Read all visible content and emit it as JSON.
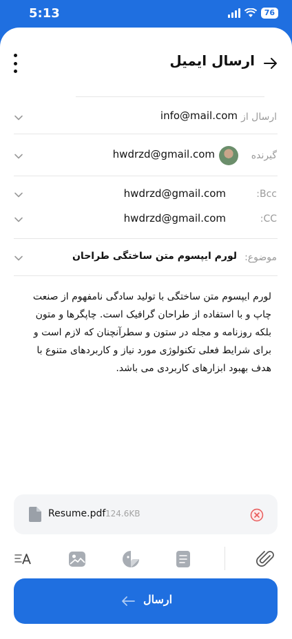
{
  "status": {
    "time": "5:13",
    "battery": "76"
  },
  "header": {
    "title": "ارسال ایمیل"
  },
  "fields": {
    "from": {
      "label": "ارسال از",
      "value": "info@mail.com"
    },
    "to": {
      "label": "گیرنده",
      "value": "hwdrzd@gmail.com"
    },
    "bcc": {
      "label": "Bcc:",
      "value": "hwdrzd@gmail.com"
    },
    "cc": {
      "label": "CC:",
      "value": "hwdrzd@gmail.com"
    },
    "subject": {
      "label": "موضوع:",
      "value": "لورم ایپسوم متن ساختگی طراحان"
    }
  },
  "body": "لورم ایپسوم متن ساختگی با تولید سادگی نامفهوم از صنعت چاپ و با استفاده از طراحان گرافیک است. چاپگرها و متون بلکه روزنامه و مجله در ستون و سطرآنچنان که لازم است و برای شرایط فعلی تکنولوژی مورد نیاز و کاربردهای متنوع با هدف بهبود ابزارهای کاربردی می باشد.",
  "attachment": {
    "name": "Resume.pdf",
    "size": "124.6KB"
  },
  "send": {
    "label": "ارسال"
  },
  "colors": {
    "accent": "#1f6fe0",
    "remove": "#e85a5a"
  },
  "icons": [
    "text-format-icon",
    "image-icon",
    "sticker-icon",
    "document-icon",
    "paperclip-icon"
  ]
}
